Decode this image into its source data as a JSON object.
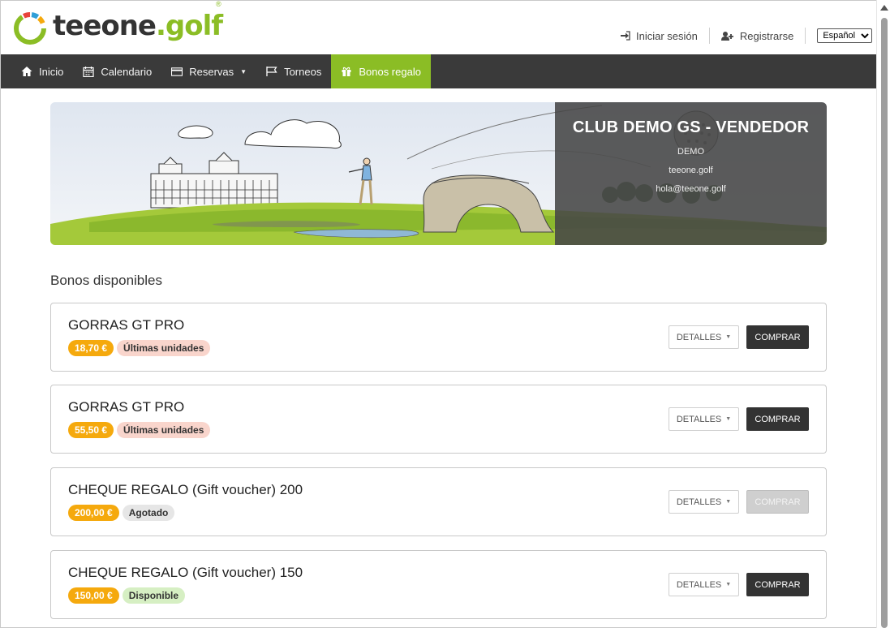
{
  "header": {
    "logo_text_a": "teeone",
    "logo_text_b": ".golf",
    "logo_reg": "®",
    "login_label": "Iniciar sesión",
    "register_label": "Registrarse",
    "language_selected": "Español",
    "language_options": [
      "Español"
    ]
  },
  "nav": {
    "items": [
      {
        "label": "Inicio",
        "icon": "home-icon"
      },
      {
        "label": "Calendario",
        "icon": "calendar-icon"
      },
      {
        "label": "Reservas",
        "icon": "credit-card-icon"
      },
      {
        "label": "Torneos",
        "icon": "flag-icon"
      },
      {
        "label": "Bonos regalo",
        "icon": "gift-icon",
        "active": true
      }
    ],
    "active_color": "#8bbd25"
  },
  "banner": {
    "club_name": "CLUB DEMO GS - VENDEDOR",
    "line1": "DEMO",
    "line2": "teeone.golf",
    "line3": "hola@teeone.golf"
  },
  "section": {
    "title": "Bonos disponibles"
  },
  "bonos": [
    {
      "title": "GORRAS GT PRO",
      "price": "18,70 €",
      "status": "Últimas unidades",
      "status_color": "#f9d5cc",
      "details_label": "DETALLES",
      "buy_label": "COMPRAR",
      "buy_enabled": true
    },
    {
      "title": "GORRAS GT PRO",
      "price": "55,50 €",
      "status": "Últimas unidades",
      "status_color": "#f9d5cc",
      "details_label": "DETALLES",
      "buy_label": "COMPRAR",
      "buy_enabled": true
    },
    {
      "title": "CHEQUE REGALO (Gift voucher) 200",
      "price": "200,00 €",
      "status": "Agotado",
      "status_color": "#e6e6e6",
      "details_label": "DETALLES",
      "buy_label": "COMPRAR",
      "buy_enabled": false
    },
    {
      "title": "CHEQUE REGALO (Gift voucher) 150",
      "price": "150,00 €",
      "status": "Disponible",
      "status_color": "#d6efc3",
      "details_label": "DETALLES",
      "buy_label": "COMPRAR",
      "buy_enabled": true
    }
  ],
  "colors": {
    "price_badge": "#f5a90d",
    "brand_green": "#8bbd25",
    "nav_bg": "#3a3a3a"
  }
}
